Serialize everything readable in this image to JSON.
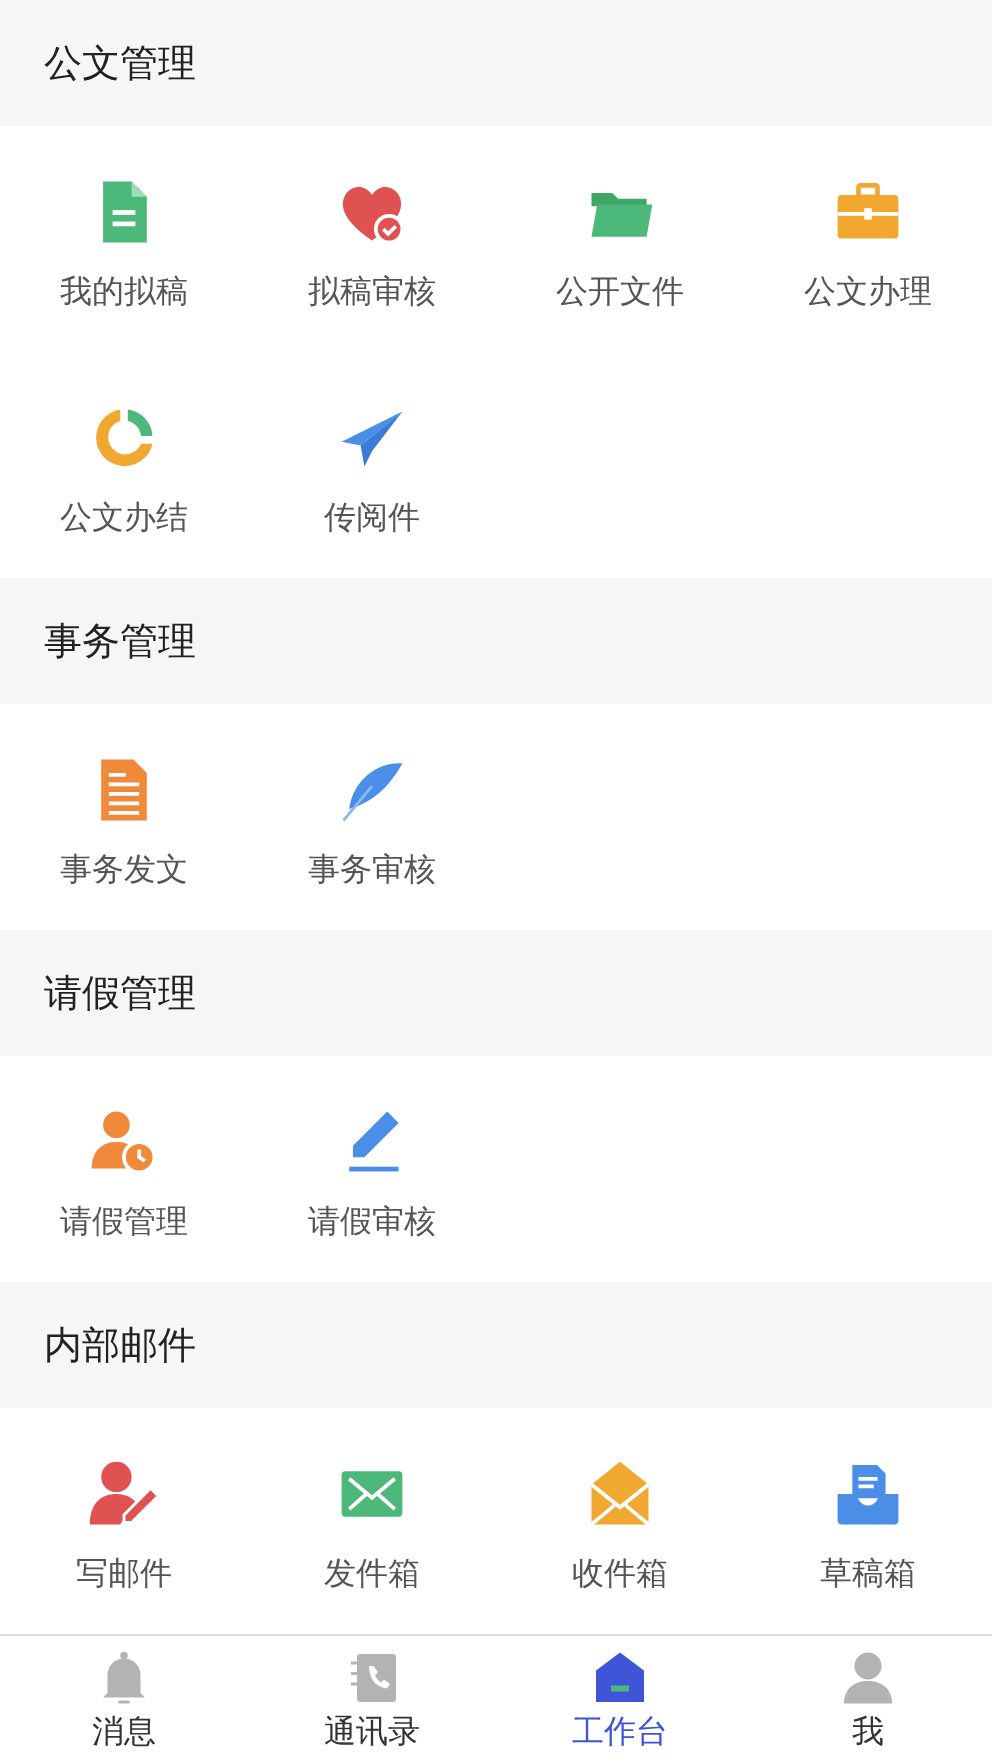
{
  "sections": [
    {
      "title": "公文管理",
      "items": [
        {
          "kind": "doc",
          "label": "我的拟稿"
        },
        {
          "kind": "heart",
          "label": "拟稿审核"
        },
        {
          "kind": "folder",
          "label": "公开文件"
        },
        {
          "kind": "case",
          "label": "公文办理"
        },
        {
          "kind": "ring",
          "label": "公文办结"
        },
        {
          "kind": "plane",
          "label": "传阅件"
        }
      ]
    },
    {
      "title": "事务管理",
      "items": [
        {
          "kind": "lines",
          "label": "事务发文"
        },
        {
          "kind": "feather",
          "label": "事务审核"
        }
      ]
    },
    {
      "title": "请假管理",
      "items": [
        {
          "kind": "clockman",
          "label": "请假管理"
        },
        {
          "kind": "pencil",
          "label": "请假审核"
        }
      ]
    },
    {
      "title": "内部邮件",
      "items": [
        {
          "kind": "writer",
          "label": "写邮件"
        },
        {
          "kind": "mail",
          "label": "发件箱"
        },
        {
          "kind": "openmail",
          "label": "收件箱"
        },
        {
          "kind": "inbox",
          "label": "草稿箱"
        }
      ]
    }
  ],
  "tabs": [
    {
      "kind": "bell",
      "label": "消息",
      "selected": false
    },
    {
      "kind": "book",
      "label": "通讯录",
      "selected": false
    },
    {
      "kind": "house",
      "label": "工作台",
      "selected": true
    },
    {
      "kind": "person",
      "label": "我",
      "selected": false
    }
  ]
}
